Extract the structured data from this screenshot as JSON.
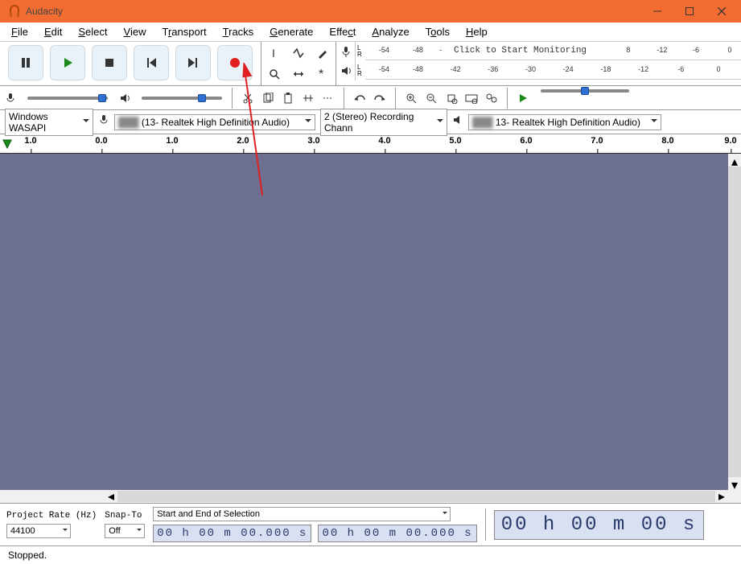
{
  "titlebar": {
    "title": "Audacity"
  },
  "menu": {
    "file": "File",
    "edit": "Edit",
    "select": "Select",
    "view": "View",
    "transport": "Transport",
    "tracks": "Tracks",
    "generate": "Generate",
    "effect": "Effect",
    "analyze": "Analyze",
    "tools": "Tools",
    "help": "Help"
  },
  "meters": {
    "L": "L",
    "R": "R",
    "click_prompt": "Click to Start Monitoring",
    "rec_ticks": [
      "-54",
      "-48",
      "-",
      "8",
      "-12",
      "-6",
      "0"
    ],
    "play_ticks": [
      "-54",
      "-48",
      "-42",
      "-36",
      "-30",
      "-24",
      "-18",
      "-12",
      "-6",
      "0"
    ]
  },
  "device": {
    "host": "Windows WASAPI",
    "rec_device": "(13- Realtek High Definition Audio)",
    "rec_channels": "2 (Stereo) Recording Chann",
    "play_device": "13- Realtek High Definition Audio)"
  },
  "ruler": {
    "ticks": [
      "1.0",
      "0.0",
      "1.0",
      "2.0",
      "3.0",
      "4.0",
      "5.0",
      "6.0",
      "7.0",
      "8.0",
      "9.0"
    ]
  },
  "selection": {
    "project_rate_label": "Project Rate (Hz)",
    "project_rate_value": "44100",
    "snap_label": "Snap-To",
    "snap_value": "Off",
    "mode": "Start and End of Selection",
    "t1": "00 h 00 m 00.000 s",
    "t2": "00 h 00 m 00.000 s",
    "bigtime": "00 h 00 m 00 s"
  },
  "status": {
    "text": "Stopped."
  }
}
